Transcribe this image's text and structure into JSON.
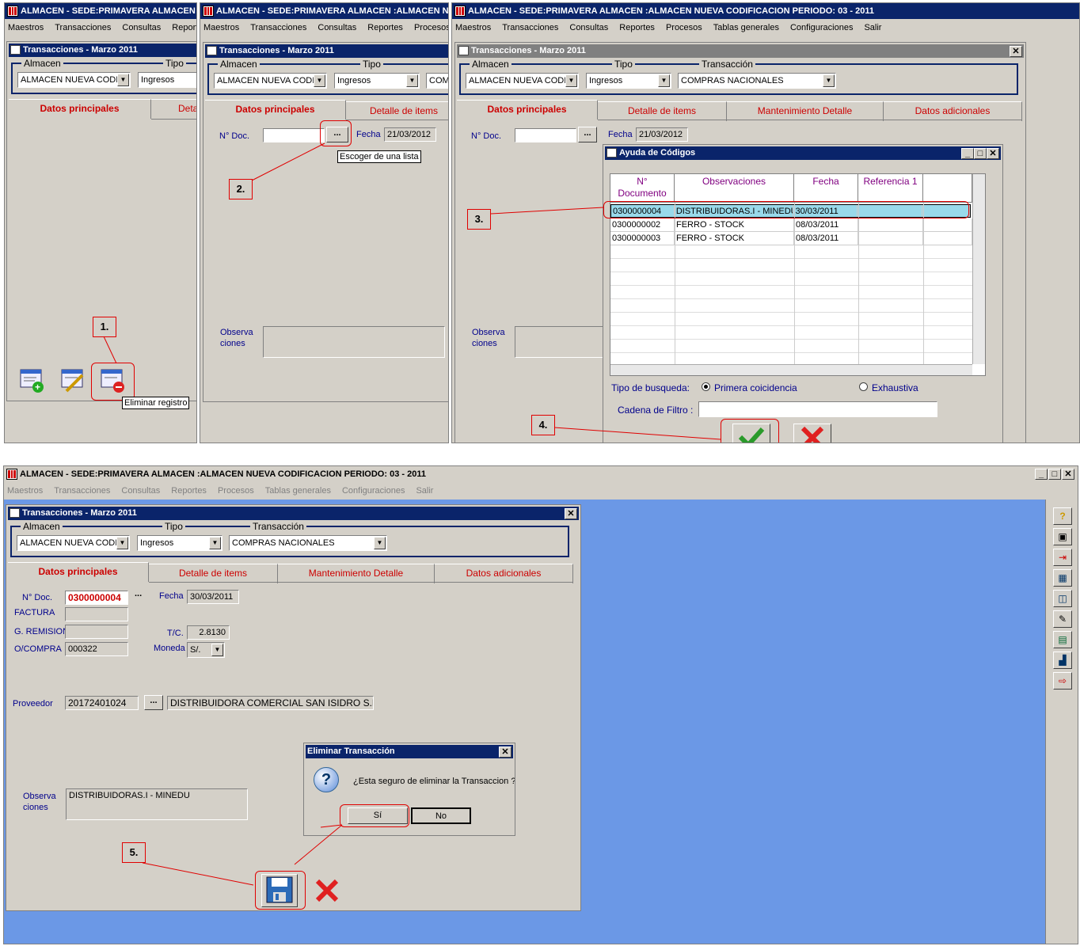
{
  "app_title_short": "ALMACEN -  SEDE:PRIMAVERA  ALMACEN :ALMACEN NUEVA CODIFICACION  PERIODO: 03 - 2011",
  "app_title_full": "ALMACEN -  SEDE:PRIMAVERA  ALMACEN :ALMACEN NUEVA CODIFICACION  PERIODO: 03 - 2011",
  "menu": [
    "Maestros",
    "Transacciones",
    "Consultas",
    "Reportes",
    "Procesos",
    "Tablas generales",
    "Configuraciones",
    "Salir"
  ],
  "form_title": "Transacciones - Marzo 2011",
  "labels": {
    "almacen": "Almacen",
    "tipo": "Tipo",
    "transaccion": "Transacción",
    "ndoc": "N° Doc.",
    "fecha": "Fecha",
    "observa": "Observa",
    "ciones": "ciones",
    "factura": "FACTURA",
    "gremision": "G. REMISION",
    "ocompra": "O/COMPRA",
    "tc": "T/C.",
    "moneda": "Moneda",
    "proveedor": "Proveedor"
  },
  "combos": {
    "almacen": "ALMACEN NUEVA CODIF",
    "tipo": "Ingresos",
    "transaccion": "COMPRAS NACIONALES",
    "transaccion_cut": "COMI"
  },
  "tabs": [
    "Datos principales",
    "Detalle de items",
    "Mantenimiento Detalle",
    "Datos adicionales"
  ],
  "tab_cut": "Deta",
  "step_labels": [
    "1.",
    "2.",
    "3.",
    "4.",
    "5."
  ],
  "tooltips": {
    "eliminar": "Eliminar registro",
    "escoger": "Escoger de una lista"
  },
  "panel2": {
    "fecha": "21/03/2012",
    "ellipsis": "..."
  },
  "lookup": {
    "title": "Ayuda de Códigos",
    "columns": [
      "N°",
      "Documento",
      "Observaciones",
      "Fecha",
      "Referencia 1"
    ],
    "rows": [
      [
        "0300000004",
        "DISTRIBUIDORAS.I - MINEDU",
        "30/03/2011",
        ""
      ],
      [
        "0300000002",
        "FERRO - STOCK",
        "08/03/2011",
        ""
      ],
      [
        "0300000003",
        "FERRO - STOCK",
        "08/03/2011",
        ""
      ]
    ],
    "tipo_busqueda": "Tipo de busqueda:",
    "opt1": "Primera coicidencia",
    "opt2": "Exhaustiva",
    "cadena": "Cadena de Filtro :"
  },
  "main": {
    "ndoc": "0300000004",
    "fecha": "30/03/2011",
    "tc": "2.8130",
    "ocompra": "000322",
    "moneda": "S/.",
    "proveedor_ruc": "20172401024",
    "proveedor_nombre": "DISTRIBUIDORA COMERCIAL SAN ISIDRO S.R",
    "observaciones": "DISTRIBUIDORAS.I - MINEDU"
  },
  "confirm": {
    "title": "Eliminar Transacción",
    "message": "¿Esta seguro de eliminar la Transaccion ?",
    "yes": "Sí",
    "no": "No"
  },
  "colors": {
    "titlebar": "#0a246a",
    "desktop": "#6b98e6",
    "accent_red": "#cc0000",
    "label_blue": "#00008b"
  }
}
